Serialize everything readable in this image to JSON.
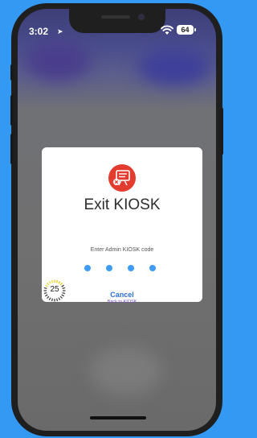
{
  "status_bar": {
    "time": "3:02",
    "location_glyph": "➤",
    "battery": "64"
  },
  "dialog": {
    "icon": "kiosk-exit-icon",
    "title": "Exit KIOSK",
    "prompt": "Enter Admin KIOSK code",
    "pin_dots_count": 4,
    "countdown": "25",
    "cancel_label": "Cancel",
    "cancel_sublabel": "Back to KIOSK"
  },
  "colors": {
    "background": "#3399f3",
    "accent_red": "#e43b2f",
    "pin_dot": "#3f9cf5",
    "cancel_text": "#2c6fd6",
    "cancel_sub_text": "#7a4fc0"
  }
}
